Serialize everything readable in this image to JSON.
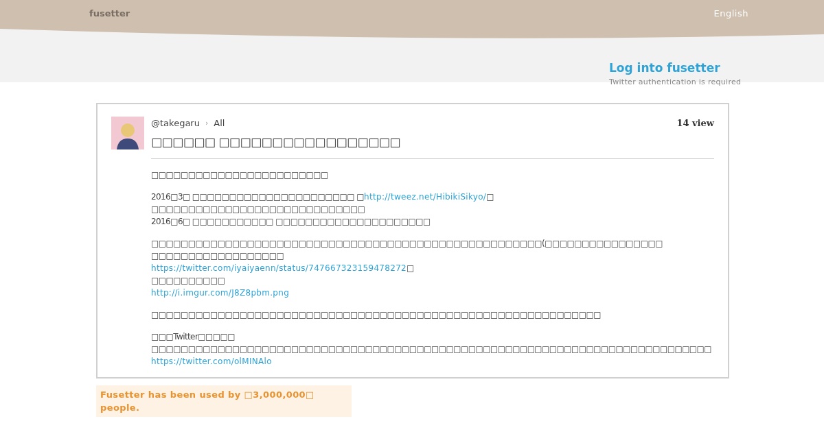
{
  "header": {
    "logo": "fusetter",
    "language": "English"
  },
  "login": {
    "title": "Log into fusetter",
    "note": "Twitter authentication is required"
  },
  "post": {
    "user": "@takegaru",
    "separator": "›",
    "category": "All",
    "views": "14 view",
    "title": "□□□□□□ □□□□□□□□□□□□□□□□□",
    "body": [
      [
        [
          {
            "kind": "text",
            "text": "□□□□□□□□□□□□□□□□□□□□□□□□"
          }
        ]
      ],
      [
        [
          {
            "kind": "text",
            "text": "2016□3□ □□□□□□□□□□□□□□□□□□□□□□ □"
          },
          {
            "kind": "link",
            "text": "http://tweez.net/HibikiSikyo/"
          },
          {
            "kind": "text",
            "text": "□"
          }
        ],
        [
          {
            "kind": "text",
            "text": "□□□□□□□□□□□□□□□□□□□□□□□□□□□□□"
          }
        ],
        [
          {
            "kind": "text",
            "text": "2016□6□ □□□□□□□□□□□ □□□□□□□□□□□□□□□□□□□□□"
          }
        ]
      ],
      [
        [
          {
            "kind": "text",
            "text": "□□□□□□□□□□□□□□□□□□□□□□□□□□□□□□□□□□□□□□□□□□□□□□□□□□□□□(□□□□□□□□□□□□□□□□ □□□□□□□□□□□□□□□□□□"
          }
        ],
        [
          {
            "kind": "link",
            "text": "https://twitter.com/iyaiyaenn/status/747667323159478272"
          },
          {
            "kind": "text",
            "text": "□"
          }
        ],
        [
          {
            "kind": "text",
            "text": "□□□□□□□□□□"
          }
        ],
        [
          {
            "kind": "link",
            "text": "http://i.imgur.com/J8Z8pbm.png"
          }
        ]
      ],
      [
        [
          {
            "kind": "text",
            "text": "□□□□□□□□□□□□□□□□□□□□□□□□□□□□□□□□□□□□□□□□□□□□□□□□□□□□□□□□□□□□□"
          }
        ]
      ],
      [
        [
          {
            "kind": "text",
            "text": "□□□Twitter□□□□□ □□□□□□□□□□□□□□□□□□□□□□□□□□□□□□□□□□□□□□□□□□□□□□□□□□□□□□□□□□□□□□□□□□□□□□□□□□□□"
          }
        ],
        [
          {
            "kind": "link",
            "text": "https://twitter.com/olMINAlo"
          }
        ]
      ]
    ]
  },
  "footer_note": "Fusetter has been used by □3,000,000□ people."
}
